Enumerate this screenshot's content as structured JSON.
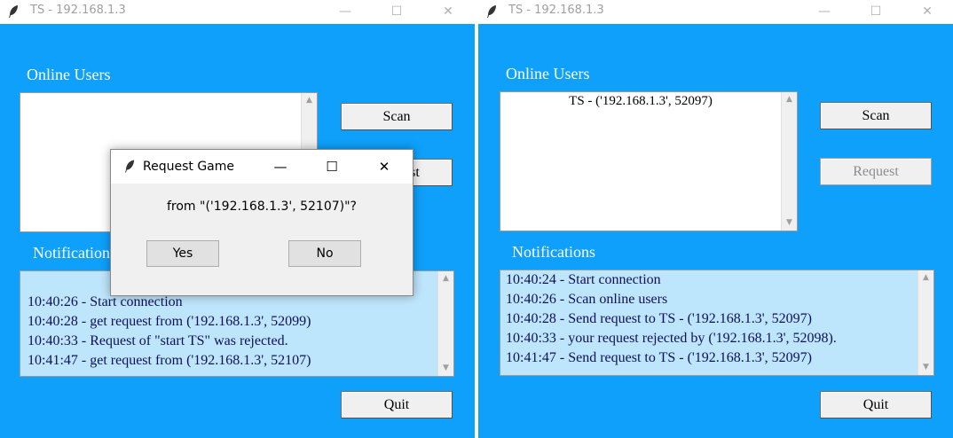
{
  "windows": [
    {
      "title": "TS - 192.168.1.3",
      "online_label": "Online Users",
      "notifications_label": "Notifications",
      "scan_label": "Scan",
      "request_label": "Request",
      "quit_label": "Quit",
      "online_users": [],
      "notifications": [
        "10:40:26 - Start connection",
        "10:40:28 - get request from ('192.168.1.3', 52099)",
        "10:40:33 - Request of \"start TS\" was rejected.",
        "10:41:47 - get request from ('192.168.1.3', 52107)"
      ]
    },
    {
      "title": "TS - 192.168.1.3",
      "online_label": "Online Users",
      "notifications_label": "Notifications",
      "scan_label": "Scan",
      "request_label": "Request",
      "quit_label": "Quit",
      "online_users": [
        "TS - ('192.168.1.3', 52097)"
      ],
      "notifications": [
        "10:40:24 - Start connection",
        "10:40:26 - Scan online users",
        "10:40:28 - Send request to TS - ('192.168.1.3', 52097)",
        "10:40:33 - your request rejected by ('192.168.1.3', 52098).",
        "10:41:47 - Send request to TS - ('192.168.1.3', 52097)"
      ]
    }
  ],
  "dialog": {
    "title": "Request Game",
    "message": "from \"('192.168.1.3', 52107)\"?",
    "yes_label": "Yes",
    "no_label": "No"
  },
  "glyphs": {
    "minimize": "—",
    "maximize": "☐",
    "close": "✕",
    "scroll_up": "▲",
    "scroll_down": "▼"
  },
  "colors": {
    "window_bg": "#0ea0fa",
    "notification_bg": "#bde5fb"
  }
}
